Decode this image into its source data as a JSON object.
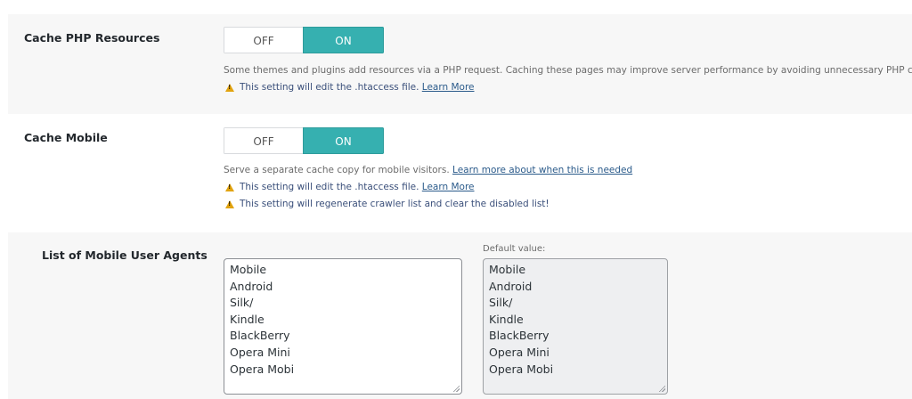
{
  "settings": {
    "cache_php": {
      "label": "Cache PHP Resources",
      "off_label": "OFF",
      "on_label": "ON",
      "state": "ON",
      "description": "Some themes and plugins add resources via a PHP request. Caching these pages may improve server performance by avoiding unnecessary PHP calls.",
      "note": "This setting will edit the .htaccess file.",
      "note_link": "Learn More"
    },
    "cache_mobile": {
      "label": "Cache Mobile",
      "off_label": "OFF",
      "on_label": "ON",
      "state": "ON",
      "description": "Serve a separate cache copy for mobile visitors.",
      "description_link": "Learn more about when this is needed",
      "note1": "This setting will edit the .htaccess file.",
      "note1_link": "Learn More",
      "note2": "This setting will regenerate crawler list and clear the disabled list!"
    },
    "mobile_agents": {
      "label": "List of Mobile User Agents",
      "values": [
        "Mobile",
        "Android",
        "Silk/",
        "Kindle",
        "BlackBerry",
        "Opera Mini",
        "Opera Mobi"
      ],
      "default_label": "Default value:",
      "default_values": [
        "Mobile",
        "Android",
        "Silk/",
        "Kindle",
        "BlackBerry",
        "Opera Mini",
        "Opera Mobi"
      ]
    }
  },
  "colors": {
    "toggle_on": "#36b0b0",
    "row_gray": "#f7f7f7",
    "warning": "#e2a30e",
    "link": "#2a5a8a"
  },
  "icons": {
    "warning": "warning-icon"
  }
}
